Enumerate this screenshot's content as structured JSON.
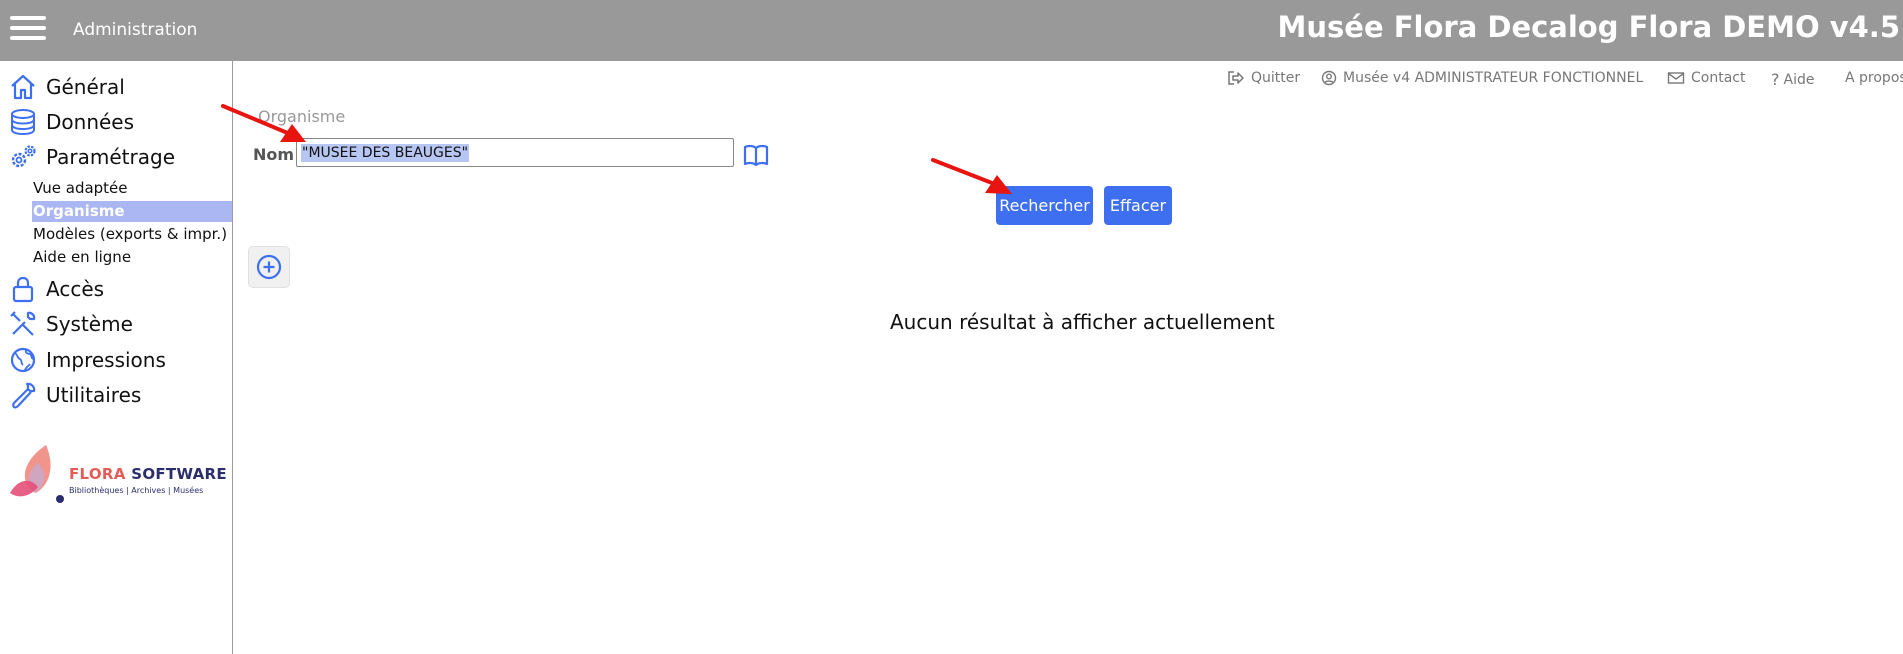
{
  "topbar": {
    "section_title": "Administration",
    "app_title": "Musée Flora Decalog Flora DEMO v4.5"
  },
  "sidebar": {
    "items": [
      {
        "label": "Général",
        "icon": "home-icon"
      },
      {
        "label": "Données",
        "icon": "database-icon"
      },
      {
        "label": "Paramétrage",
        "icon": "gears-icon"
      },
      {
        "label": "Accès",
        "icon": "lock-icon"
      },
      {
        "label": "Système",
        "icon": "tools-icon"
      },
      {
        "label": "Impressions",
        "icon": "globe-icon"
      },
      {
        "label": "Utilitaires",
        "icon": "wrench-icon"
      }
    ],
    "sub_items": [
      {
        "label": "Vue adaptée"
      },
      {
        "label": "Organisme"
      },
      {
        "label": "Modèles (exports & impr.)"
      },
      {
        "label": "Aide en ligne"
      }
    ],
    "active_sub_item": "Organisme"
  },
  "logo": {
    "brand_1": "FLORA",
    "brand_2": "SOFTWARE",
    "tagline": "Bibliothèques | Archives | Musées"
  },
  "header_links": {
    "quit": "Quitter",
    "user": "Musée v4 ADMINISTRATEUR FONCTIONNEL",
    "contact": "Contact",
    "help": "Aide",
    "about": "A propos"
  },
  "form": {
    "breadcrumb": "Organisme",
    "nom_label": "Nom",
    "nom_value": "\"MUSEE DES BEAUGES\"",
    "search_button": "Rechercher",
    "clear_button": "Effacer"
  },
  "results": {
    "empty_message": "Aucun résultat à afficher actuellement"
  },
  "colors": {
    "topbar": "#999999",
    "accent": "#3d6ff0",
    "active_sub_item": "#aab7f2",
    "annotation_arrow": "#e8140f"
  }
}
